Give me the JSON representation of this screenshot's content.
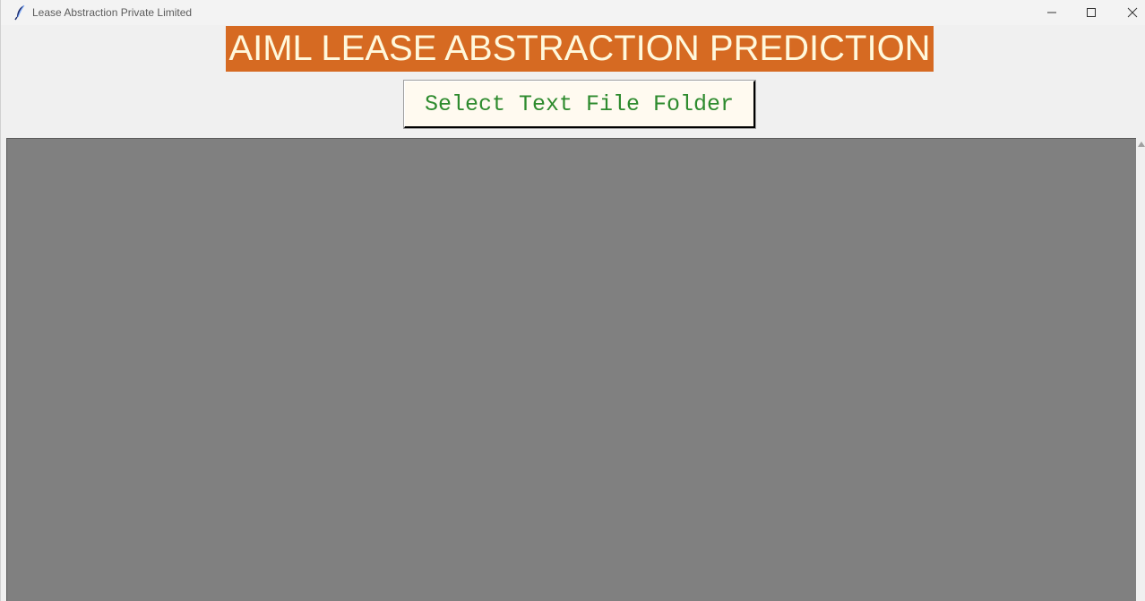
{
  "window": {
    "title": "Lease Abstraction Private Limited",
    "icons": {
      "app": "feather-icon",
      "minimize": "minimize-icon",
      "maximize": "maximize-icon",
      "close": "close-icon"
    }
  },
  "header": {
    "banner_text": "AIML LEASE ABSTRACTION PREDICTION",
    "banner_bg": "#d66a22",
    "banner_fg": "#fff8dc"
  },
  "actions": {
    "select_folder_label": "Select Text File Folder",
    "select_folder_fg": "#2e8b2e",
    "select_folder_bg": "#fffaf0"
  },
  "output": {
    "canvas_bg": "#808080"
  }
}
